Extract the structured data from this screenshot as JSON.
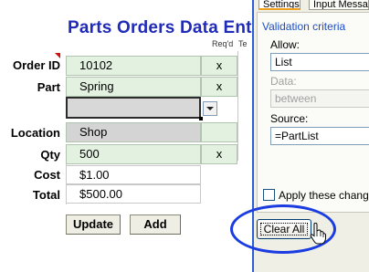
{
  "form": {
    "title": "Parts Orders Data Entry",
    "reqd_header": "Req'd",
    "te_header": "Te",
    "rows": {
      "order_id": {
        "label": "Order ID",
        "value": "10102",
        "required": "x"
      },
      "part": {
        "label": "Part",
        "value": "Spring",
        "required": "x"
      },
      "location": {
        "label": "Location",
        "value": "Shop"
      },
      "qty": {
        "label": "Qty",
        "value": "500",
        "required": "x"
      },
      "cost": {
        "label": "Cost",
        "value": "$1.00"
      },
      "total": {
        "label": "Total",
        "value": "$500.00"
      }
    },
    "buttons": {
      "update": "Update",
      "add": "Add"
    }
  },
  "dialog": {
    "tabs": {
      "settings": "Settings",
      "input_message": "Input Messa"
    },
    "group_title": "Validation criteria",
    "allow": {
      "label": "Allow:",
      "value": "List"
    },
    "data": {
      "label": "Data:",
      "value": "between"
    },
    "source": {
      "label": "Source:",
      "value": "=PartList"
    },
    "apply_checkbox": {
      "label": "Apply these changes",
      "checked": false
    },
    "clear_all_button": "Clear All"
  },
  "colors": {
    "title": "#1f2ab8",
    "required_cell": "#e2f1e0",
    "highlight_ellipse": "#1a3ce0",
    "group_title": "#1b4ec4"
  },
  "icons": {
    "cursor": "hand-pointer-icon",
    "dropdown": "chevron-down-icon"
  }
}
